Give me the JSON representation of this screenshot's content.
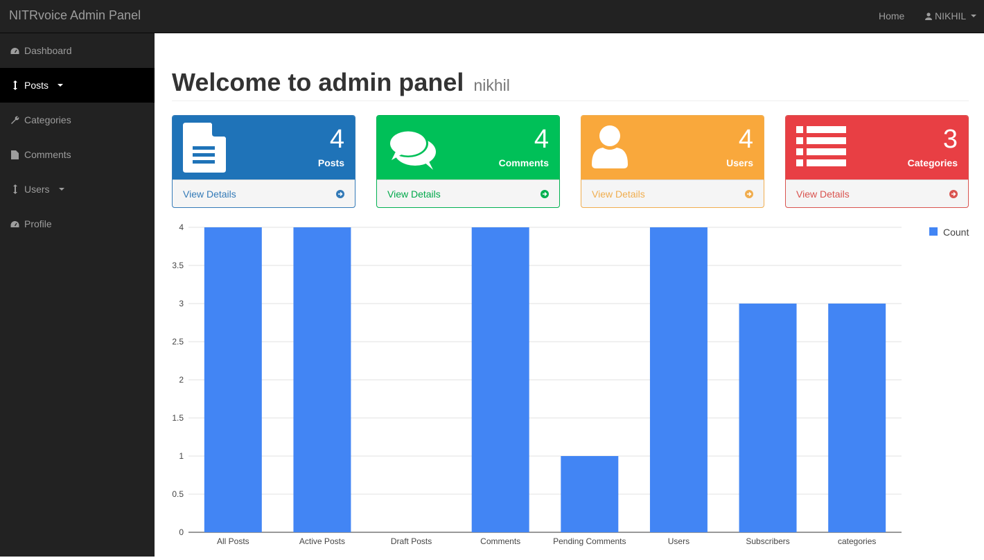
{
  "app": {
    "brand": "NITRvoice Admin Panel"
  },
  "topnav": {
    "home": "Home",
    "user": "NIKHIL"
  },
  "sidebar": {
    "items": [
      {
        "label": "Dashboard",
        "icon": "dashboard-icon"
      },
      {
        "label": "Posts",
        "icon": "vertical-arrows-icon"
      },
      {
        "label": "Categories",
        "icon": "wrench-icon"
      },
      {
        "label": "Comments",
        "icon": "file-icon"
      },
      {
        "label": "Users",
        "icon": "vertical-arrows-icon"
      },
      {
        "label": "Profile",
        "icon": "dashboard-icon"
      }
    ]
  },
  "header": {
    "title": "Welcome to admin panel",
    "subtitle": "nikhil"
  },
  "panels": [
    {
      "count": "4",
      "label": "Posts",
      "link": "View Details",
      "color": "#337ab7",
      "accent": "#337ab7"
    },
    {
      "count": "4",
      "label": "Comments",
      "link": "View Details",
      "color": "#00c058",
      "accent": "#00b050"
    },
    {
      "count": "4",
      "label": "Users",
      "link": "View Details",
      "color": "#f9a83c",
      "accent": "#f0ad4e"
    },
    {
      "count": "3",
      "label": "Categories",
      "link": "View Details",
      "color": "#e83f44",
      "accent": "#d9534f"
    }
  ],
  "chart_data": {
    "type": "bar",
    "categories": [
      "All Posts",
      "Active Posts",
      "Draft Posts",
      "Comments",
      "Pending Comments",
      "Users",
      "Subscribers",
      "categories"
    ],
    "series": [
      {
        "name": "Count",
        "values": [
          4,
          4,
          0,
          4,
          1,
          4,
          3,
          3
        ],
        "color": "#4285f4"
      }
    ],
    "ylim": [
      0,
      4
    ],
    "yticks": [
      "0",
      "0.5",
      "1",
      "1.5",
      "2",
      "2.5",
      "3",
      "3.5",
      "4"
    ],
    "grid": true,
    "legend": "top-right"
  }
}
